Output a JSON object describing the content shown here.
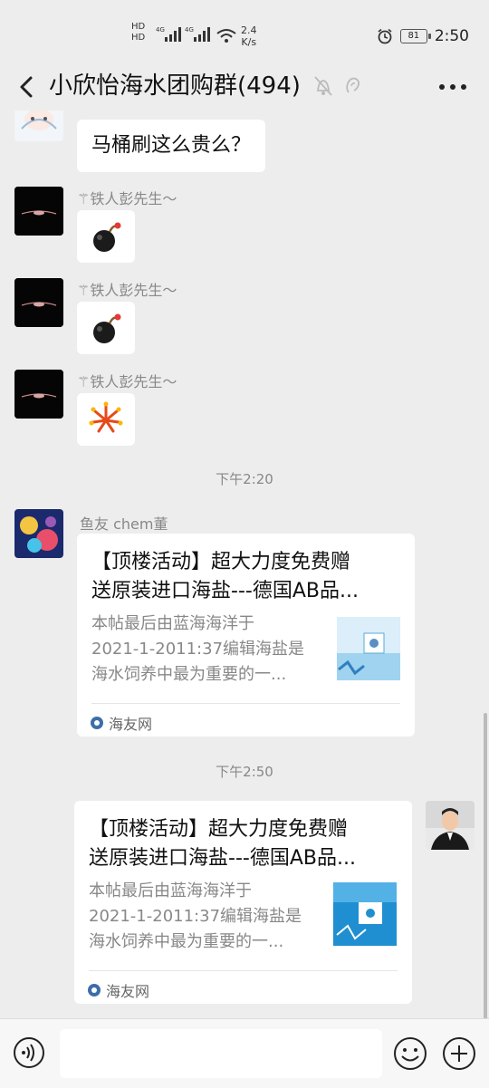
{
  "status_bar": {
    "hd_top": "HD",
    "hd_bottom": "HD",
    "net1": "4G",
    "net2": "4G",
    "speed_value": "2.4",
    "speed_unit": "K/s",
    "battery": "81",
    "time": "2:50"
  },
  "header": {
    "title": "小欣怡海水团购群(494)"
  },
  "messages": {
    "m1_text": "马桶刷这么贵么？",
    "m2_sender": "铁人彭先生",
    "m3_sender": "铁人彭先生",
    "m4_sender": "铁人彭先生",
    "time1": "下午2:20",
    "m5_sender": "鱼友 chem董",
    "time2": "下午2:50"
  },
  "card1": {
    "title_line1": "【顶楼活动】超大力度免费赠",
    "title_line2": "送原装进口海盐---德国AB品...",
    "desc_line1": "本帖最后由蓝海海洋于",
    "desc_line2": "2021-1-2011:37编辑海盐是",
    "desc_line3": "海水饲养中最为重要的一...",
    "source": "海友网"
  },
  "card2": {
    "title_line1": "【顶楼活动】超大力度免费赠",
    "title_line2": "送原装进口海盐---德国AB品...",
    "desc_line1": "本帖最后由蓝海海洋于",
    "desc_line2": "2021-1-2011:37编辑海盐是",
    "desc_line3": "海水饲养中最为重要的一...",
    "source": "海友网"
  },
  "input": {
    "placeholder": ""
  },
  "colors": {
    "background": "#ededed",
    "bubble": "#ffffff",
    "meta_text": "#888888",
    "source_icon": "#3c6ea8"
  }
}
